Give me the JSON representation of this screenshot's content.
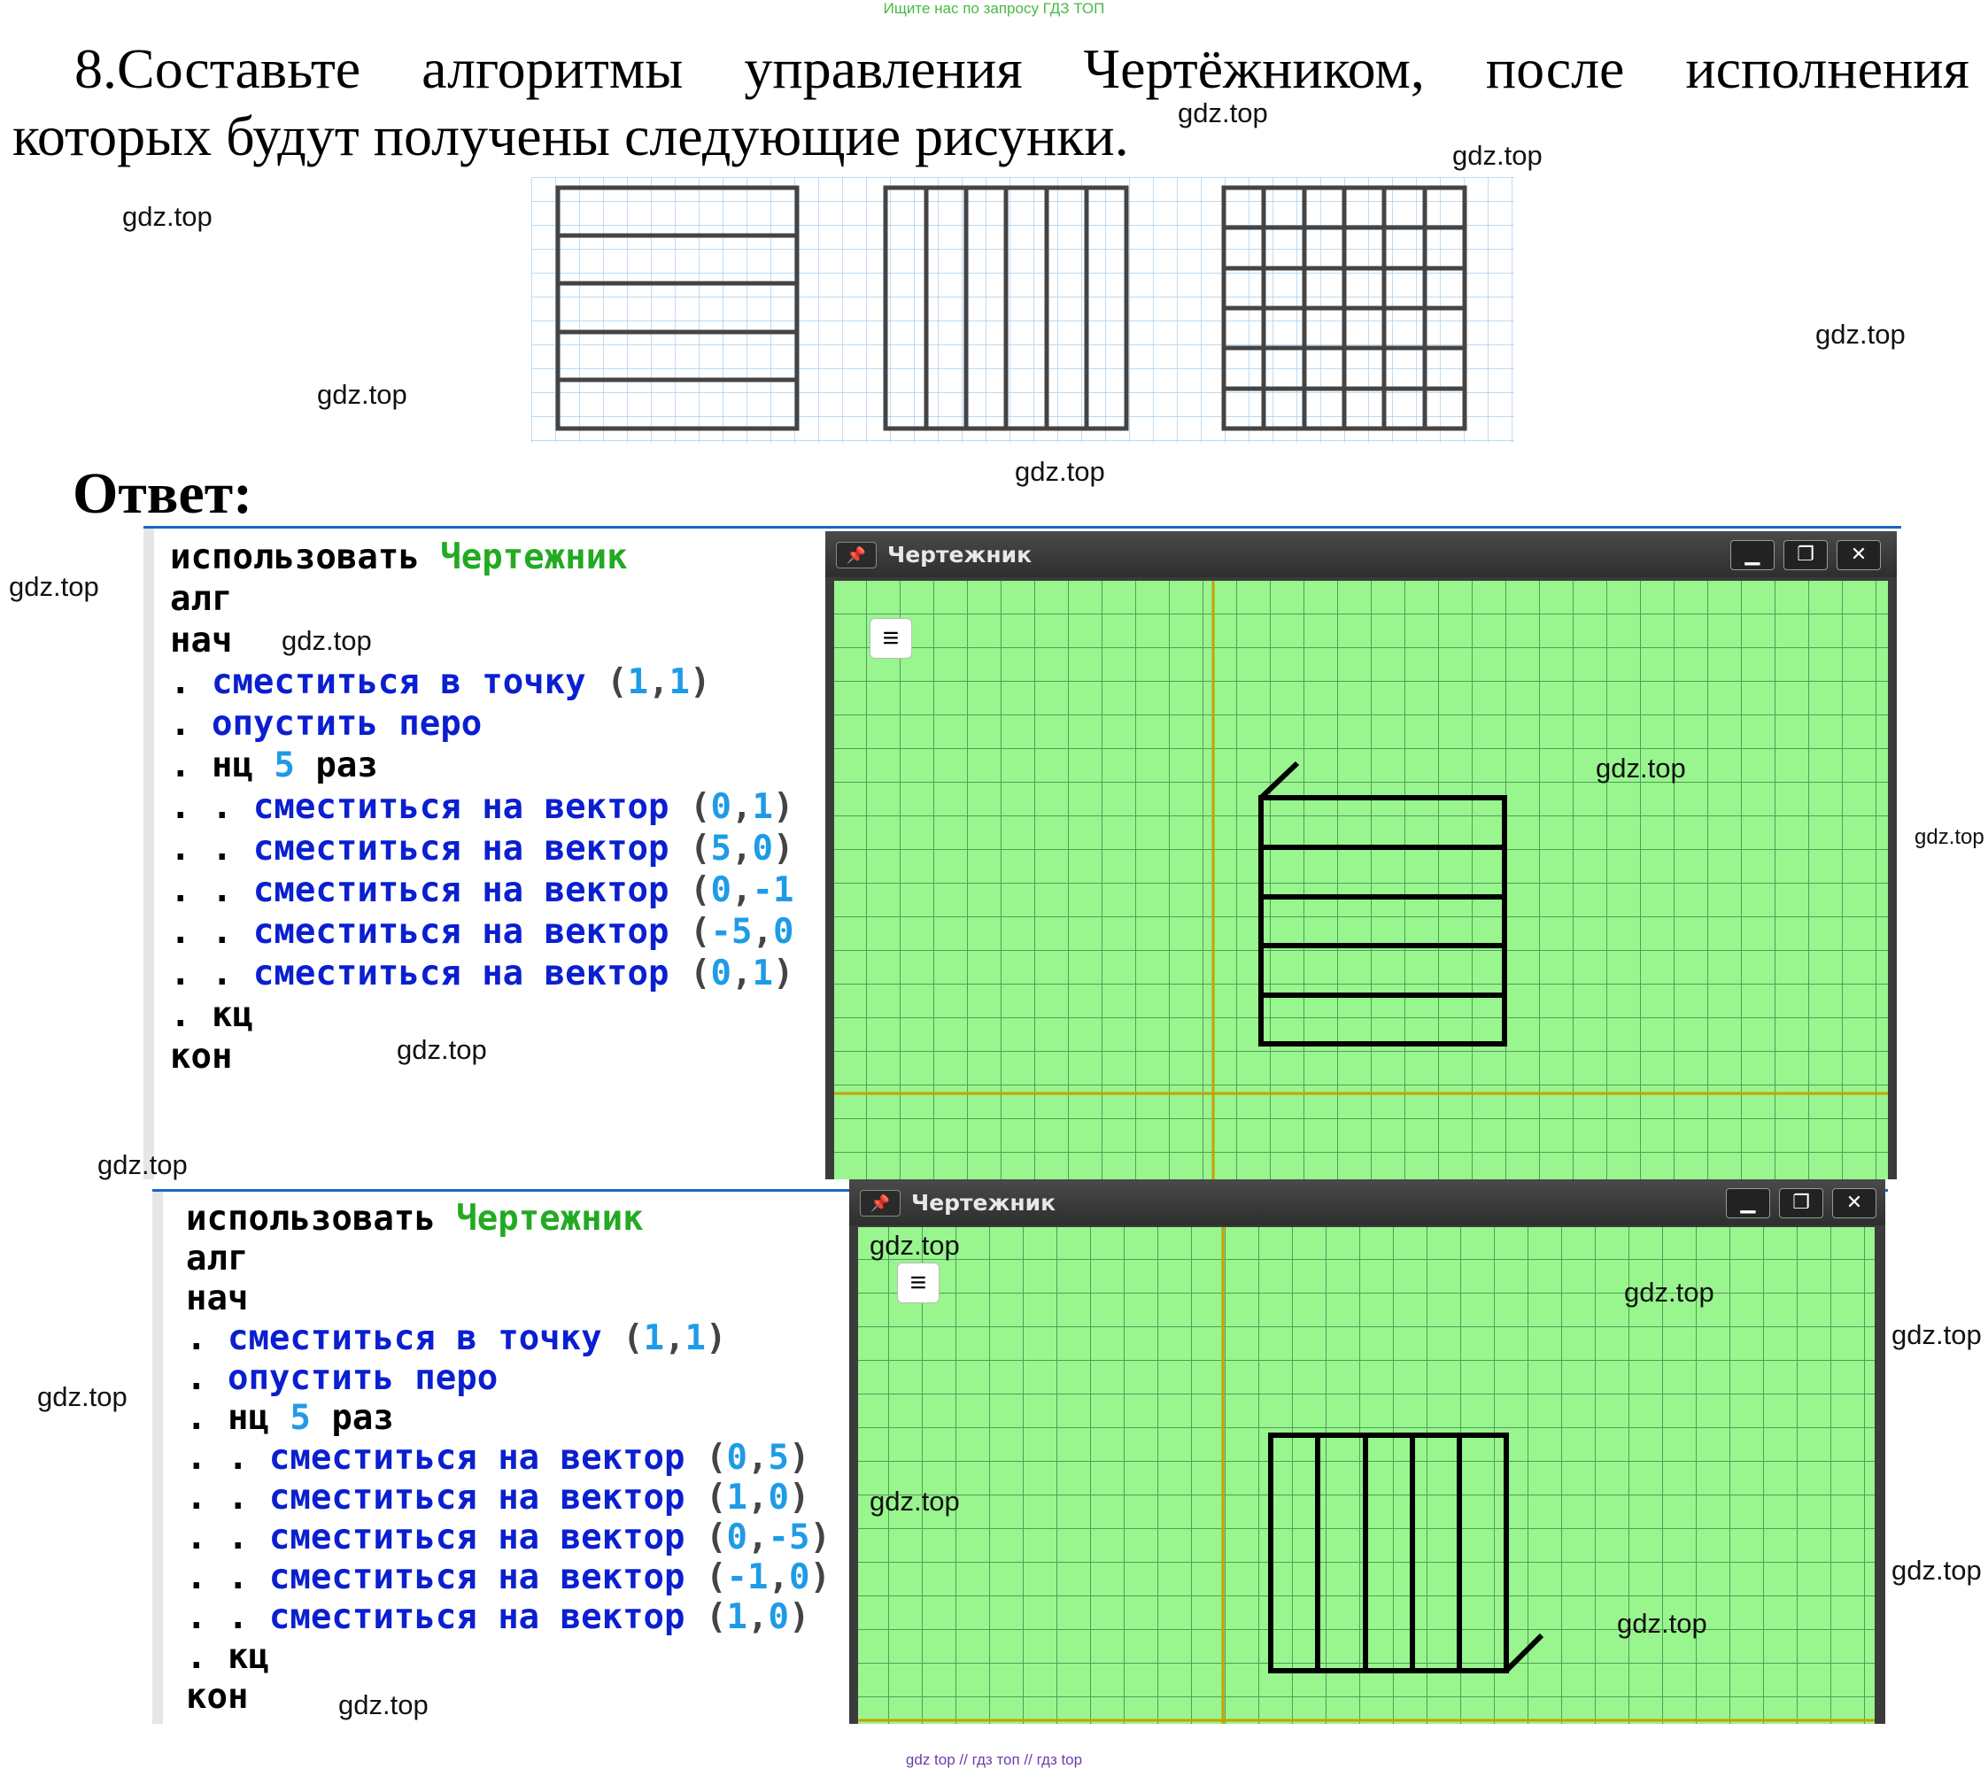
{
  "banner": "Ищите нас по запросу ГДЗ ТОП",
  "task": {
    "line1": [
      "8.Составьте",
      "алгоритмы",
      "управления",
      "Чертёжником,",
      "после",
      "исполнения"
    ],
    "line2": "которых будут получены следующие рисунки."
  },
  "answer_label": "Ответ:",
  "watermark": "gdz.top",
  "footer": "gdz top  //  гдз топ  //  гдз top",
  "window_title": "Чертежник",
  "icons": {
    "pin": "pin-icon",
    "minimize": "minimize-icon",
    "maximize": "maximize-icon",
    "close": "close-icon",
    "menu": "menu-icon"
  },
  "colors": {
    "grid_background": "#99f58e",
    "grid_lines": "#4f9f58",
    "axis": "#c8a000",
    "keyword_executor": "#22aa22",
    "command": "#0a1fd0",
    "number": "#1e9be6"
  },
  "programs": [
    {
      "lines": [
        [
          {
            "t": "использовать ",
            "c": "kw"
          },
          {
            "t": "Чертежник",
            "c": "ok"
          }
        ],
        [
          {
            "t": "алг",
            "c": "kw"
          }
        ],
        [
          {
            "t": "нач",
            "c": "kw"
          }
        ],
        [
          {
            "t": ". ",
            "c": "kw"
          },
          {
            "t": "сместиться в точку ",
            "c": "cmd"
          },
          {
            "t": "(",
            "c": "par"
          },
          {
            "t": "1",
            "c": "num"
          },
          {
            "t": ",",
            "c": "par"
          },
          {
            "t": "1",
            "c": "num"
          },
          {
            "t": ")",
            "c": "par"
          }
        ],
        [
          {
            "t": ". ",
            "c": "kw"
          },
          {
            "t": "опустить перо",
            "c": "cmd"
          }
        ],
        [
          {
            "t": ". ",
            "c": "kw"
          },
          {
            "t": "нц ",
            "c": "kw"
          },
          {
            "t": "5",
            "c": "num"
          },
          {
            "t": " раз",
            "c": "kw"
          }
        ],
        [
          {
            "t": ". . ",
            "c": "kw"
          },
          {
            "t": "сместиться на вектор ",
            "c": "cmd"
          },
          {
            "t": "(",
            "c": "par"
          },
          {
            "t": "0",
            "c": "num"
          },
          {
            "t": ",",
            "c": "par"
          },
          {
            "t": "1",
            "c": "num"
          },
          {
            "t": ")",
            "c": "par"
          }
        ],
        [
          {
            "t": ". . ",
            "c": "kw"
          },
          {
            "t": "сместиться на вектор ",
            "c": "cmd"
          },
          {
            "t": "(",
            "c": "par"
          },
          {
            "t": "5",
            "c": "num"
          },
          {
            "t": ",",
            "c": "par"
          },
          {
            "t": "0",
            "c": "num"
          },
          {
            "t": ")",
            "c": "par"
          }
        ],
        [
          {
            "t": ". . ",
            "c": "kw"
          },
          {
            "t": "сместиться на вектор ",
            "c": "cmd"
          },
          {
            "t": "(",
            "c": "par"
          },
          {
            "t": "0",
            "c": "num"
          },
          {
            "t": ",",
            "c": "par"
          },
          {
            "t": "-1",
            "c": "num"
          }
        ],
        [
          {
            "t": ". . ",
            "c": "kw"
          },
          {
            "t": "сместиться на вектор ",
            "c": "cmd"
          },
          {
            "t": "(",
            "c": "par"
          },
          {
            "t": "-5",
            "c": "num"
          },
          {
            "t": ",",
            "c": "par"
          },
          {
            "t": "0",
            "c": "num"
          }
        ],
        [
          {
            "t": ". . ",
            "c": "kw"
          },
          {
            "t": "сместиться на вектор ",
            "c": "cmd"
          },
          {
            "t": "(",
            "c": "par"
          },
          {
            "t": "0",
            "c": "num"
          },
          {
            "t": ",",
            "c": "par"
          },
          {
            "t": "1",
            "c": "num"
          },
          {
            "t": ")",
            "c": "par"
          }
        ],
        [
          {
            "t": ". кц",
            "c": "kw"
          }
        ],
        [
          {
            "t": "кон",
            "c": "kw"
          }
        ]
      ]
    },
    {
      "lines": [
        [
          {
            "t": "использовать ",
            "c": "kw"
          },
          {
            "t": "Чертежник",
            "c": "ok"
          }
        ],
        [
          {
            "t": "алг",
            "c": "kw"
          }
        ],
        [
          {
            "t": "нач",
            "c": "kw"
          }
        ],
        [
          {
            "t": ". ",
            "c": "kw"
          },
          {
            "t": "сместиться в точку ",
            "c": "cmd"
          },
          {
            "t": "(",
            "c": "par"
          },
          {
            "t": "1",
            "c": "num"
          },
          {
            "t": ",",
            "c": "par"
          },
          {
            "t": "1",
            "c": "num"
          },
          {
            "t": ")",
            "c": "par"
          }
        ],
        [
          {
            "t": ". ",
            "c": "kw"
          },
          {
            "t": "опустить перо",
            "c": "cmd"
          }
        ],
        [
          {
            "t": ". ",
            "c": "kw"
          },
          {
            "t": "нц ",
            "c": "kw"
          },
          {
            "t": "5",
            "c": "num"
          },
          {
            "t": " раз",
            "c": "kw"
          }
        ],
        [
          {
            "t": ". . ",
            "c": "kw"
          },
          {
            "t": "сместиться на вектор ",
            "c": "cmd"
          },
          {
            "t": "(",
            "c": "par"
          },
          {
            "t": "0",
            "c": "num"
          },
          {
            "t": ",",
            "c": "par"
          },
          {
            "t": "5",
            "c": "num"
          },
          {
            "t": ")",
            "c": "par"
          }
        ],
        [
          {
            "t": ". . ",
            "c": "kw"
          },
          {
            "t": "сместиться на вектор ",
            "c": "cmd"
          },
          {
            "t": "(",
            "c": "par"
          },
          {
            "t": "1",
            "c": "num"
          },
          {
            "t": ",",
            "c": "par"
          },
          {
            "t": "0",
            "c": "num"
          },
          {
            "t": ")",
            "c": "par"
          }
        ],
        [
          {
            "t": ". . ",
            "c": "kw"
          },
          {
            "t": "сместиться на вектор ",
            "c": "cmd"
          },
          {
            "t": "(",
            "c": "par"
          },
          {
            "t": "0",
            "c": "num"
          },
          {
            "t": ",",
            "c": "par"
          },
          {
            "t": "-5",
            "c": "num"
          },
          {
            "t": ")",
            "c": "par"
          }
        ],
        [
          {
            "t": ". . ",
            "c": "kw"
          },
          {
            "t": "сместиться на вектор ",
            "c": "cmd"
          },
          {
            "t": "(",
            "c": "par"
          },
          {
            "t": "-1",
            "c": "num"
          },
          {
            "t": ",",
            "c": "par"
          },
          {
            "t": "0",
            "c": "num"
          },
          {
            "t": ")",
            "c": "par"
          }
        ],
        [
          {
            "t": ". . ",
            "c": "kw"
          },
          {
            "t": "сместиться на вектор ",
            "c": "cmd"
          },
          {
            "t": "(",
            "c": "par"
          },
          {
            "t": "1",
            "c": "num"
          },
          {
            "t": ",",
            "c": "par"
          },
          {
            "t": "0",
            "c": "num"
          },
          {
            "t": ")",
            "c": "par"
          }
        ],
        [
          {
            "t": ". кц",
            "c": "kw"
          }
        ],
        [
          {
            "t": "кон",
            "c": "kw"
          }
        ]
      ]
    }
  ]
}
